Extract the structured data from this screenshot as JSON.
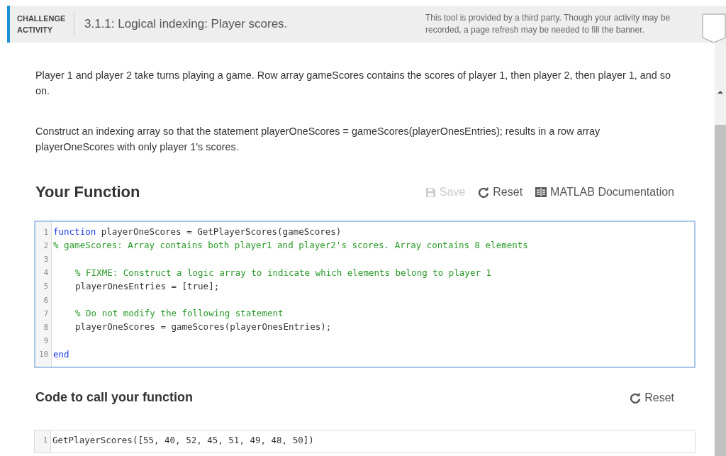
{
  "banner": {
    "label": "CHALLENGE ACTIVITY",
    "title": "3.1.1: Logical indexing: Player scores.",
    "notice": "This tool is provided by a third party. Though your activity may be recorded, a page refresh may be needed to fill the banner."
  },
  "instructions": [
    "Player 1 and player 2 take turns playing a game. Row array gameScores contains the scores of player 1, then player 2, then player 1, and so on.",
    "Construct an indexing array so that the statement playerOneScores = gameScores(playerOnesEntries); results in a row array playerOneScores with only player 1's scores."
  ],
  "function_section": {
    "heading": "Your Function",
    "toolbar": [
      {
        "kind": "save",
        "label": "Save",
        "disabled": true
      },
      {
        "kind": "reset",
        "label": "Reset",
        "disabled": false
      },
      {
        "kind": "docs",
        "label": "MATLAB Documentation",
        "disabled": false
      }
    ],
    "editor": {
      "focused": true,
      "lines": [
        {
          "number": "1",
          "segments": [
            {
              "kind": "keyword",
              "text": "function"
            },
            {
              "kind": "plain",
              "text": " playerOneScores = GetPlayerScores(gameScores)"
            }
          ]
        },
        {
          "number": "2",
          "segments": [
            {
              "kind": "comment",
              "text": "% gameScores: Array contains both player1 and player2's scores. Array contains 8 elements"
            }
          ]
        },
        {
          "number": "3"
        },
        {
          "number": "4",
          "indent": true,
          "segments": [
            {
              "kind": "comment",
              "text": "% FIXME: Construct a logic array to indicate which elements belong to player 1"
            }
          ]
        },
        {
          "number": "5",
          "indent": true,
          "segments": [
            {
              "kind": "plain",
              "text": "playerOnesEntries = [true];"
            }
          ]
        },
        {
          "number": "6"
        },
        {
          "number": "7",
          "indent": true,
          "segments": [
            {
              "kind": "comment",
              "text": "% Do not modify the following statement"
            }
          ]
        },
        {
          "number": "8",
          "indent": true,
          "segments": [
            {
              "kind": "plain",
              "text": "playerOneScores = gameScores(playerOnesEntries);"
            }
          ]
        },
        {
          "number": "9"
        },
        {
          "number": "10",
          "segments": [
            {
              "kind": "keyword",
              "text": "end"
            }
          ]
        }
      ]
    }
  },
  "call_section": {
    "heading": "Code to call your function",
    "toolbar": [
      {
        "kind": "reset",
        "label": "Reset",
        "disabled": false
      }
    ],
    "editor": {
      "focused": false,
      "lines": [
        {
          "number": "1",
          "segments": [
            {
              "kind": "plain",
              "text": "GetPlayerScores([55, 40, 52, 45, 51, 49, 48, 50])"
            }
          ]
        }
      ]
    }
  }
}
